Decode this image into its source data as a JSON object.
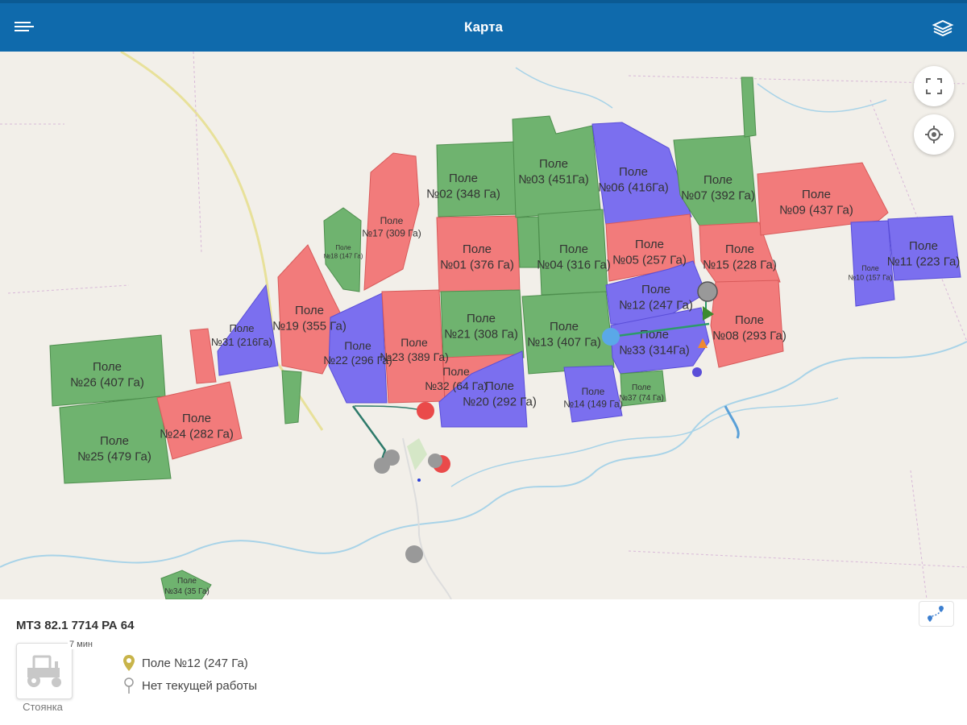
{
  "header": {
    "title": "Карта"
  },
  "icons": {
    "menu": "menu-icon",
    "layers": "layers-icon",
    "fullscreen": "fullscreen-icon",
    "locate": "locate-icon",
    "route": "route-icon",
    "tractor": "tractor-icon",
    "field_pin": "map-pin-icon",
    "work_pin": "pin-icon"
  },
  "colors": {
    "header": "#0f6aac",
    "field_green": "#6fb36f",
    "field_red": "#f27b7b",
    "field_blue": "#7b6fef"
  },
  "fields": [
    {
      "id": "26",
      "status": "green",
      "line1": "Поле",
      "line2": "№26 (407 Га)"
    },
    {
      "id": "25",
      "status": "green",
      "line1": "Поле",
      "line2": "№25 (479 Га)"
    },
    {
      "id": "24",
      "status": "red",
      "line1": "Поле",
      "line2": "№24 (282 Га)"
    },
    {
      "id": "small-red",
      "status": "red",
      "line1": "",
      "line2": ""
    },
    {
      "id": "31",
      "status": "blue",
      "line1": "Поле",
      "line2": "№31 (216Га)"
    },
    {
      "id": "19",
      "status": "red",
      "line1": "Поле",
      "line2": "№19 (355 Га)"
    },
    {
      "id": "18",
      "status": "green",
      "line1": "Поле",
      "line2": "№18 (147 Га)"
    },
    {
      "id": "17",
      "status": "red",
      "line1": "Поле",
      "line2": "№17 (309 Га)"
    },
    {
      "id": "22",
      "status": "blue",
      "line1": "Поле",
      "line2": "№22 (296 Га)"
    },
    {
      "id": "23",
      "status": "red",
      "line1": "Поле",
      "line2": "№23 (389 Га)"
    },
    {
      "id": "02",
      "status": "green",
      "line1": "Поле",
      "line2": "№02 (348 Га)"
    },
    {
      "id": "01",
      "status": "red",
      "line1": "Поле",
      "line2": "№01 (376 Га)"
    },
    {
      "id": "21",
      "status": "green",
      "line1": "Поле",
      "line2": "№21 (308 Га)"
    },
    {
      "id": "32",
      "status": "red",
      "line1": "Поле",
      "line2": "№32 (64 Га)"
    },
    {
      "id": "20",
      "status": "blue",
      "line1": "Поле",
      "line2": "№20 (292 Га)"
    },
    {
      "id": "03",
      "status": "green",
      "line1": "Поле",
      "line2": "№03 (451Га)"
    },
    {
      "id": "04",
      "status": "green",
      "line1": "Поле",
      "line2": "№04 (316 Га)"
    },
    {
      "id": "13",
      "status": "green",
      "line1": "Поле",
      "line2": "№13 (407 Га)"
    },
    {
      "id": "06",
      "status": "blue",
      "line1": "Поле",
      "line2": "№06 (416Га)"
    },
    {
      "id": "05",
      "status": "red",
      "line1": "Поле",
      "line2": "№05 (257 Га)"
    },
    {
      "id": "12",
      "status": "blue",
      "line1": "Поле",
      "line2": "№12 (247 Га)"
    },
    {
      "id": "33",
      "status": "blue",
      "line1": "Поле",
      "line2": "№33 (314Га)"
    },
    {
      "id": "14",
      "status": "blue",
      "line1": "Поле",
      "line2": "№14 (149 Га)"
    },
    {
      "id": "37",
      "status": "green",
      "line1": "Поле",
      "line2": "№37 (74 Га)"
    },
    {
      "id": "07",
      "status": "green",
      "line1": "Поле",
      "line2": "№07 (392 Га)"
    },
    {
      "id": "15",
      "status": "red",
      "line1": "Поле",
      "line2": "№15 (228 Га)"
    },
    {
      "id": "08",
      "status": "red",
      "line1": "Поле",
      "line2": "№08 (293 Га)"
    },
    {
      "id": "09",
      "status": "red",
      "line1": "Поле",
      "line2": "№09 (437 Га)"
    },
    {
      "id": "10",
      "status": "blue",
      "line1": "Поле",
      "line2": "№10 (157 Га)"
    },
    {
      "id": "11",
      "status": "blue",
      "line1": "Поле",
      "line2": "№11 (223 Га)"
    },
    {
      "id": "34",
      "status": "green",
      "line1": "Поле",
      "line2": "№34 (35 Га)"
    }
  ],
  "vehicle": {
    "name": "МТЗ 82.1 7714 РА 64",
    "time": "7 мин",
    "status": "Стоянка",
    "field": "Поле №12 (247 Га)",
    "work": "Нет текущей работы"
  }
}
